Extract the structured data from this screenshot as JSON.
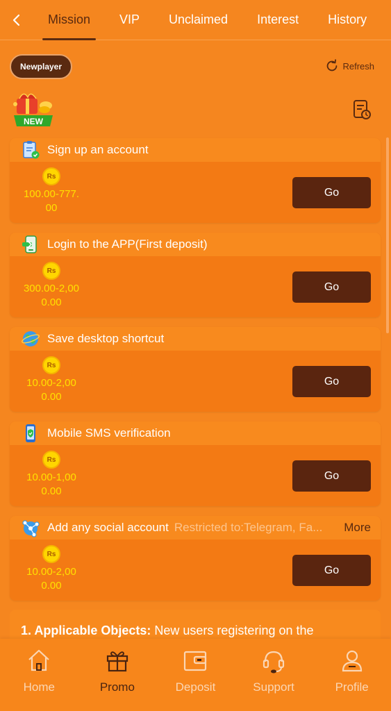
{
  "nav": {
    "tabs": [
      {
        "label": "Mission"
      },
      {
        "label": "VIP"
      },
      {
        "label": "Unclaimed"
      },
      {
        "label": "Interest"
      },
      {
        "label": "History"
      }
    ],
    "active_tab": "Mission"
  },
  "header": {
    "newplayer_label": "Newplayer",
    "refresh_label": "Refresh",
    "new_badge": "NEW"
  },
  "missions": [
    {
      "title": "Sign up an account",
      "currency": "Rs",
      "amount_line1": "100.00-777.",
      "amount_line2": "00",
      "button": "Go",
      "icon": "clipboard-check-icon"
    },
    {
      "title": "Login to the APP(First deposit)",
      "currency": "Rs",
      "amount_line1": "300.00-2,00",
      "amount_line2": "0.00",
      "button": "Go",
      "icon": "app-download-icon"
    },
    {
      "title": "Save desktop shortcut",
      "currency": "Rs",
      "amount_line1": "10.00-2,00",
      "amount_line2": "0.00",
      "button": "Go",
      "icon": "globe-icon"
    },
    {
      "title": "Mobile SMS verification",
      "currency": "Rs",
      "amount_line1": "10.00-1,00",
      "amount_line2": "0.00",
      "button": "Go",
      "icon": "phone-shield-icon"
    },
    {
      "title": "Add any social account",
      "restriction": "Restricted to:Telegram, Fa...",
      "more": "More",
      "currency": "Rs",
      "amount_line1": "10.00-2,00",
      "amount_line2": "0.00",
      "button": "Go",
      "icon": "social-network-icon"
    }
  ],
  "rules": {
    "heading": "1. Applicable Objects:",
    "text": " New users registering on the"
  },
  "bottom_nav": [
    {
      "label": "Home",
      "icon": "home-icon"
    },
    {
      "label": "Promo",
      "icon": "gift-icon"
    },
    {
      "label": "Deposit",
      "icon": "wallet-icon"
    },
    {
      "label": "Support",
      "icon": "headset-icon"
    },
    {
      "label": "Profile",
      "icon": "user-icon"
    }
  ],
  "active_bottom": "Promo",
  "colors": {
    "background": "#f5861f",
    "button": "#5a250f",
    "amount": "#ffe100",
    "coin": "#ffd600"
  }
}
